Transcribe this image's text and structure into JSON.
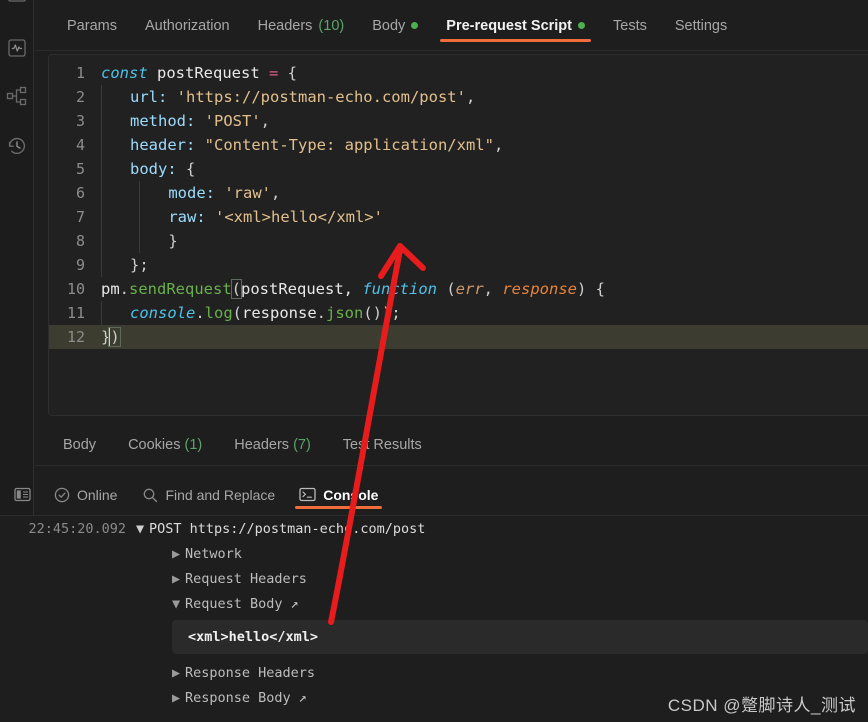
{
  "rail": {
    "icons": [
      {
        "name": "runner-icon",
        "glyph": "bars"
      },
      {
        "name": "monitor-pulse-icon",
        "glyph": "pulse"
      },
      {
        "name": "flow-diagram-icon",
        "glyph": "flow"
      },
      {
        "name": "history-clock-icon",
        "glyph": "history"
      }
    ]
  },
  "request_tabs": [
    {
      "label": "Params",
      "active": false,
      "count": null,
      "dot": false
    },
    {
      "label": "Authorization",
      "active": false,
      "count": null,
      "dot": false
    },
    {
      "label": "Headers",
      "active": false,
      "count": "(10)",
      "dot": false
    },
    {
      "label": "Body",
      "active": false,
      "count": null,
      "dot": true
    },
    {
      "label": "Pre-request Script",
      "active": true,
      "count": null,
      "dot": true
    },
    {
      "label": "Tests",
      "active": false,
      "count": null,
      "dot": false
    },
    {
      "label": "Settings",
      "active": false,
      "count": null,
      "dot": false
    }
  ],
  "editor": {
    "line_numbers": [
      "1",
      "2",
      "3",
      "4",
      "5",
      "6",
      "7",
      "8",
      "9",
      "10",
      "11",
      "12"
    ],
    "highlighted_line": 12,
    "code_text": [
      "const postRequest = {",
      "    url: 'https://postman-echo.com/post',",
      "    method: 'POST',",
      "    header: \"Content-Type: application/xml\",",
      "    body: {",
      "        mode: 'raw',",
      "        raw: '<xml>hello</xml>'",
      "        }",
      "    };",
      "pm.sendRequest(postRequest, function (err, response) {",
      "    console.log(response.json());",
      "})"
    ],
    "tokens": {
      "l1": {
        "kw": "const",
        "name": " postRequest ",
        "op": "=",
        "brace": " {"
      },
      "l2": {
        "key": "url:",
        "str": "'https://postman-echo.com/post'",
        "tail": ","
      },
      "l3": {
        "key": "method:",
        "str": "'POST'",
        "tail": ","
      },
      "l4": {
        "key": "header:",
        "str": "\"Content-Type: application/xml\"",
        "tail": ","
      },
      "l5": {
        "key": "body:",
        "brace": "{"
      },
      "l6": {
        "key": "mode:",
        "str": "'raw'",
        "tail": ","
      },
      "l7": {
        "key": "raw:",
        "str": "'<xml>hello</xml>'"
      },
      "l8": {
        "brace": "}"
      },
      "l9": {
        "brace": "};"
      },
      "l10": {
        "obj": "pm",
        "dot": ".",
        "fn": "sendRequest",
        "paren": "(",
        "arg": "postRequest, ",
        "kw": "function",
        "sp": " (",
        "a1": "err",
        "comma": ", ",
        "a2": "response",
        "close": ") {"
      },
      "l11": {
        "obj": "console",
        "dot": ".",
        "fn": "log",
        "paren": "(",
        "arg": "response",
        "dot2": ".",
        "fn2": "json",
        "close": "());"
      },
      "l12": {
        "close": "}",
        "paren": ")"
      }
    }
  },
  "response_tabs": [
    {
      "label": "Body",
      "count": null
    },
    {
      "label": "Cookies",
      "count": "(1)"
    },
    {
      "label": "Headers",
      "count": "(7)"
    },
    {
      "label": "Test Results",
      "count": null
    }
  ],
  "statusbar": {
    "sidebar_toggle": "sidebar-toggle-icon",
    "items": [
      {
        "label": "Online",
        "icon": "check-circle-icon",
        "active": false
      },
      {
        "label": "Find and Replace",
        "icon": "search-icon",
        "active": false
      },
      {
        "label": "Console",
        "icon": "terminal-icon",
        "active": true
      }
    ]
  },
  "console": {
    "timestamp": "22:45:20.092",
    "request_line": "POST https://postman-echo.com/post",
    "entries": [
      {
        "label": "Network",
        "expanded": false,
        "external": false
      },
      {
        "label": "Request Headers",
        "expanded": false,
        "external": false
      },
      {
        "label": "Request Body",
        "expanded": true,
        "external": true
      }
    ],
    "body_value": "<xml>hello</xml>",
    "entries_after": [
      {
        "label": "Response Headers",
        "expanded": false,
        "external": false
      },
      {
        "label": "Response Body",
        "expanded": false,
        "external": true
      }
    ],
    "expand_glyph": "▼",
    "collapse_glyph": "▶",
    "external_glyph": "↗"
  },
  "annotation": {
    "arrow_color": "#e81c1c",
    "name": "red-arrow-annotation"
  },
  "watermark": {
    "text": "CSDN @蹩脚诗人_测试"
  },
  "colors": {
    "accent": "#ef6c3b",
    "background": "#1e1e1e",
    "editor_bg": "#212121",
    "highlight_line": "#3c3d30",
    "green": "#5aa469",
    "dot_green": "#4caf50"
  }
}
